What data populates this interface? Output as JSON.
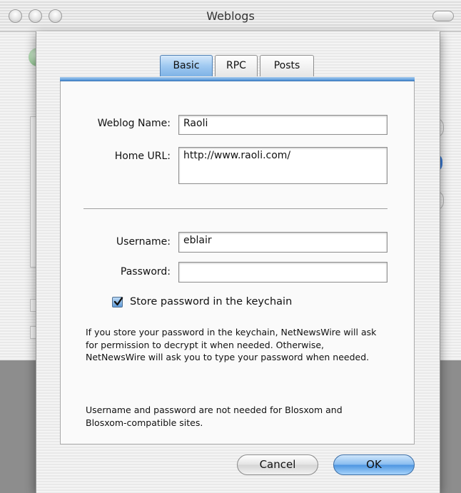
{
  "window": {
    "title": "Weblogs"
  },
  "sheet": {
    "tabs": [
      {
        "label": "Basic",
        "active": true
      },
      {
        "label": "RPC",
        "active": false
      },
      {
        "label": "Posts",
        "active": false
      }
    ],
    "weblog_name": {
      "label": "Weblog Name:",
      "value": "Raoli"
    },
    "home_url": {
      "label": "Home URL:",
      "value": "http://www.raoli.com/"
    },
    "username": {
      "label": "Username:",
      "value": "eblair"
    },
    "password": {
      "label": "Password:",
      "value": ""
    },
    "store_keychain": {
      "label": "Store password in the keychain",
      "checked": true
    },
    "info_text_1": "If you store your password in the keychain, NetNewsWire will ask for permission to decrypt it when needed. Otherwise, NetNewsWire will ask you to type your password when needed.",
    "info_text_2": "Username and password are not needed for Blosxom and Blosxom-compatible sites.",
    "buttons": {
      "cancel": "Cancel",
      "ok": "OK"
    }
  },
  "colors": {
    "accent": "#5aa0e6",
    "tab_active": "#9fc9f1"
  }
}
